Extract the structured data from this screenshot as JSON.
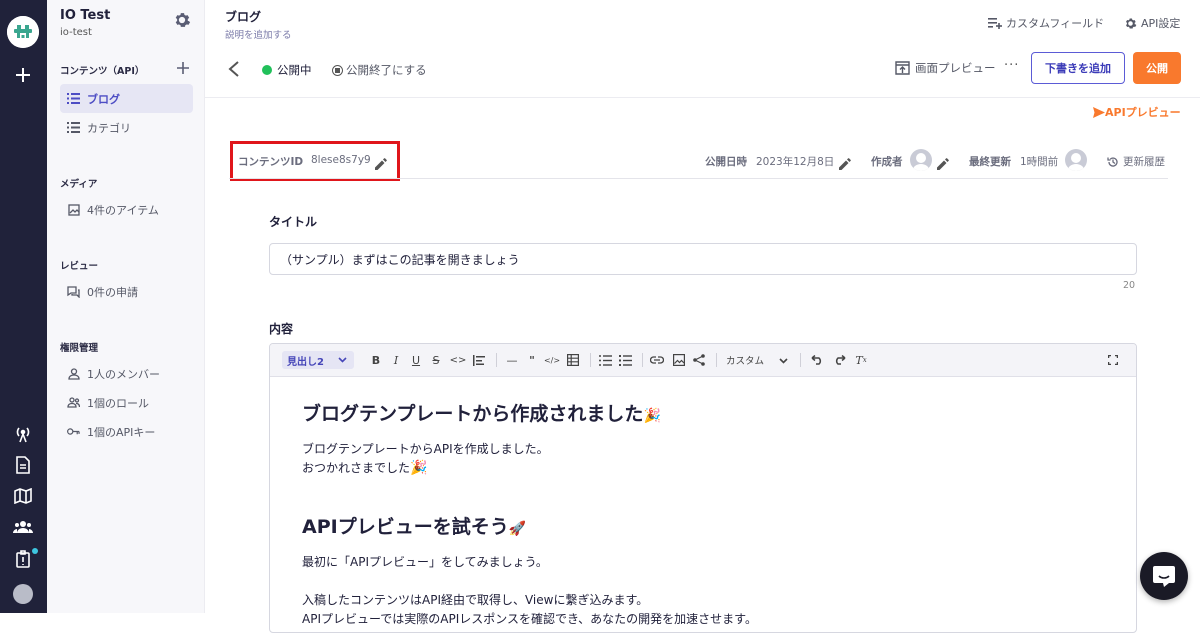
{
  "service": {
    "name": "IO Test",
    "id": "io-test"
  },
  "sidebar": {
    "contents_header": "コンテンツ（API）",
    "contents_items": [
      {
        "label": "ブログ",
        "active": true
      },
      {
        "label": "カテゴリ",
        "active": false
      }
    ],
    "media_header": "メディア",
    "media_item": "4件のアイテム",
    "review_header": "レビュー",
    "review_item": "0件の申請",
    "permission_header": "権限管理",
    "permission_items": [
      "1人のメンバー",
      "1個のロール",
      "1個のAPIキー"
    ]
  },
  "header": {
    "title": "ブログ",
    "description": "説明を追加する",
    "custom_field": "カスタムフィールド",
    "api_settings": "API設定"
  },
  "actions": {
    "status": "公開中",
    "unpublish": "公開終了にする",
    "screen_preview": "画面プレビュー",
    "add_draft": "下書きを追加",
    "publish": "公開",
    "api_preview": "APIプレビュー"
  },
  "meta": {
    "content_id_label": "コンテンツID",
    "content_id_value": "8lese8s7y9",
    "published_label": "公開日時",
    "published_value": "2023年12月8日",
    "author_label": "作成者",
    "updated_label": "最終更新",
    "updated_value": "1時間前",
    "history": "更新履歴"
  },
  "title_field": {
    "label": "タイトル",
    "value": "（サンプル）まずはこの記事を開きましょう",
    "count": "20"
  },
  "content_field": {
    "label": "内容",
    "heading_select": "見出し2",
    "custom_select": "カスタム",
    "h1": "ブログテンプレートから作成されました",
    "p1": "ブログテンプレートからAPIを作成しました。",
    "p2": "おつかれさまでした",
    "h2": "APIプレビューを試そう",
    "p3": "最初に「APIプレビュー」をしてみましょう。",
    "p4": "入稿したコンテンツはAPI経由で取得し、Viewに繋ぎ込みます。",
    "p5": "APIプレビューでは実際のAPIレスポンスを確認でき、あなたの開発を加速させます。"
  },
  "colors": {
    "rail": "#20223a",
    "accent": "#5b5bd6",
    "publish": "#f9792d",
    "highlight": "#e0161b",
    "status": "#21c05a"
  },
  "icons": [
    "logo-icon",
    "plus-icon",
    "antenna-icon",
    "document-icon",
    "map-icon",
    "team-icon",
    "clipboard-icon",
    "gear-icon",
    "list-icon",
    "image-icon",
    "review-icon",
    "person-icon",
    "group-icon",
    "key-icon",
    "pencil-icon",
    "history-icon",
    "chat-icon"
  ]
}
